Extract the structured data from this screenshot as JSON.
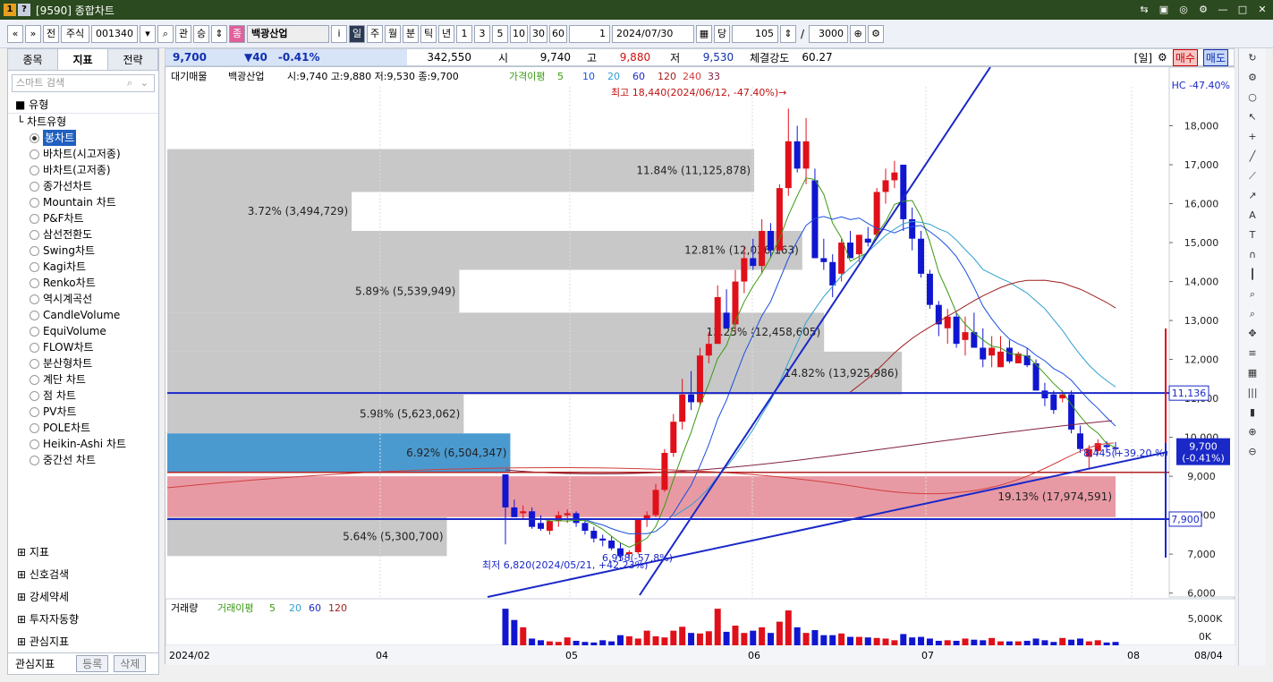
{
  "window": {
    "title": "[9590] 종합차트"
  },
  "toolbar": {
    "nav_prev": "«",
    "nav_down": "»",
    "prev_label": "전",
    "market": "주식",
    "code": "001340",
    "gwan": "관",
    "sang": "승",
    "stock_badge": "종",
    "stock_name": "백광산업",
    "info": "i",
    "periods": [
      "일",
      "주",
      "월",
      "분",
      "틱",
      "년"
    ],
    "counts": [
      "1",
      "3",
      "5",
      "10",
      "30",
      "60"
    ],
    "interval": "1",
    "date": "2024/07/30",
    "dang": "당",
    "view_count": "105",
    "slash": "/",
    "total_count": "3000"
  },
  "left_panel": {
    "tabs": [
      "종목",
      "지표",
      "전략"
    ],
    "search_placeholder": "스마트 검색",
    "section_title": "유형",
    "tree_root": "차트유형",
    "chart_types": [
      "봉차트",
      "바차트(시고저종)",
      "바차트(고저종)",
      "종가선차트",
      "Mountain 차트",
      "P&F차트",
      "삼선전환도",
      "Swing차트",
      "Kagi차트",
      "Renko차트",
      "역시계곡선",
      "CandleVolume",
      "EquiVolume",
      "FLOW차트",
      "분산형차트",
      "계단 차트",
      "점 차트",
      "PV차트",
      "POLE차트",
      "Heikin-Ashi 차트",
      "중간선 차트"
    ],
    "bottom_sections": [
      "지표",
      "신호검색",
      "강세약세",
      "투자자동향",
      "관심지표"
    ],
    "footer_label": "관심지표",
    "register": "등록",
    "delete": "삭제"
  },
  "quote": {
    "price": "9,700",
    "change": "▼40",
    "rate": "-0.41%",
    "volume": "342,550",
    "open_label": "시",
    "open": "9,740",
    "high_label": "고",
    "high": "9,880",
    "low_label": "저",
    "low": "9,530",
    "strength_label": "체결강도",
    "strength": "60.27",
    "period": "[일]",
    "buy": "매수",
    "sell": "매도"
  },
  "chart": {
    "legend_prefix": "대기매물",
    "legend_name": "백광산업",
    "legend_ohlc": "시:9,740 고:9,880 저:9,530 종:9,700",
    "ma_label": "가격이평",
    "ma_periods": [
      "5",
      "10",
      "20",
      "60",
      "120",
      "240",
      "33"
    ],
    "hc": "HC -47.40%",
    "high_note": "최고 18,440(2024/06/12, -47.40%)→",
    "low_note": "최저 6,820(2024/05/21, +42.23%)",
    "low_note2": "6,958(-57.8%)",
    "last_change_note": "8,445(+39.20 %)",
    "price_tag": "9,700",
    "price_tag2": "(-0.41%)",
    "line_tag_high": "11,136",
    "line_tag_low": "7,900",
    "x_labels": [
      "2024/02",
      "04",
      "05",
      "06",
      "07",
      "08"
    ],
    "x_right": "08/04",
    "volume_label": "거래량",
    "volume_ma_label": "거래이평",
    "volume_ma": [
      "5",
      "20",
      "60",
      "120"
    ],
    "volume_ticks": [
      "5,000K",
      "0K"
    ]
  },
  "chart_data": {
    "type": "bar",
    "y_ticks": [
      18000,
      17000,
      16000,
      15000,
      14000,
      13000,
      12000,
      11000,
      10000,
      9000,
      8000,
      7000,
      6000
    ],
    "y_tick_labels": [
      "18,000",
      "17,000",
      "16,000",
      "15,000",
      "14,000",
      "13,000",
      "12,000",
      "11,000",
      "10,000",
      "9,000",
      "8,000",
      "7,000",
      "6,000"
    ],
    "ylim": [
      5900,
      19000
    ],
    "volume_profile": [
      {
        "from": 17400,
        "to": 16300,
        "pct": 11.84,
        "label": "11.84% (11,125,878)"
      },
      {
        "from": 16300,
        "to": 15300,
        "pct": 3.72,
        "label": "3.72% (3,494,729)"
      },
      {
        "from": 15300,
        "to": 14300,
        "pct": 12.81,
        "label": "12.81% (12,036,163)"
      },
      {
        "from": 14300,
        "to": 13200,
        "pct": 5.89,
        "label": "5.89% (5,539,949)"
      },
      {
        "from": 13200,
        "to": 12200,
        "pct": 13.25,
        "label": "13.25% (12,458,605)"
      },
      {
        "from": 12200,
        "to": 11100,
        "pct": 14.82,
        "label": "14.82% (13,925,986)"
      },
      {
        "from": 11100,
        "to": 10100,
        "pct": 5.98,
        "label": "5.98% (5,623,062)"
      },
      {
        "from": 10100,
        "to": 9100,
        "pct": 6.92,
        "label": "6.92% (6,504,347)"
      },
      {
        "from": 9000,
        "to": 7950,
        "pct": 19.13,
        "label": "19.13% (17,974,591)"
      },
      {
        "from": 7950,
        "to": 6950,
        "pct": 5.64,
        "label": "5.64% (5,300,700)"
      }
    ],
    "candles": [
      [
        9050,
        9050,
        7250,
        8200
      ],
      [
        8200,
        8400,
        7950,
        7950
      ],
      [
        8050,
        8250,
        7900,
        8100
      ],
      [
        8100,
        8200,
        7650,
        7700
      ],
      [
        7800,
        8000,
        7600,
        7650
      ],
      [
        7600,
        7900,
        7500,
        7850
      ],
      [
        7850,
        8100,
        7700,
        8000
      ],
      [
        8000,
        8150,
        7800,
        8050
      ],
      [
        8050,
        8100,
        7700,
        7800
      ],
      [
        7800,
        7900,
        7500,
        7600
      ],
      [
        7600,
        7700,
        7300,
        7400
      ],
      [
        7400,
        7500,
        7200,
        7350
      ],
      [
        7350,
        7450,
        7100,
        7150
      ],
      [
        7150,
        7300,
        6820,
        6950
      ],
      [
        7000,
        7100,
        6900,
        7050
      ],
      [
        7050,
        7900,
        7000,
        7900
      ],
      [
        7900,
        8100,
        7700,
        8000
      ],
      [
        8000,
        8800,
        7950,
        8650
      ],
      [
        8650,
        9700,
        8600,
        9600
      ],
      [
        9600,
        10600,
        9500,
        10400
      ],
      [
        10400,
        11500,
        10200,
        11100
      ],
      [
        11100,
        11700,
        10700,
        10900
      ],
      [
        10900,
        12300,
        10800,
        12100
      ],
      [
        12100,
        12700,
        11900,
        12400
      ],
      [
        12400,
        13900,
        12400,
        13600
      ],
      [
        13200,
        13800,
        12800,
        12800
      ],
      [
        12900,
        14300,
        12700,
        14000
      ],
      [
        14000,
        14900,
        13700,
        14600
      ],
      [
        14600,
        15100,
        14300,
        14400
      ],
      [
        14400,
        15600,
        14200,
        15300
      ],
      [
        15300,
        15500,
        14600,
        14800
      ],
      [
        14800,
        16500,
        14700,
        16400
      ],
      [
        16400,
        18440,
        16200,
        17600
      ],
      [
        17600,
        18000,
        16800,
        16900
      ],
      [
        16900,
        18200,
        16500,
        17600
      ],
      [
        16600,
        16900,
        14600,
        14600
      ],
      [
        14600,
        15100,
        14300,
        14500
      ],
      [
        14500,
        14700,
        13600,
        13900
      ],
      [
        14200,
        15100,
        14000,
        15000
      ],
      [
        15000,
        15300,
        14600,
        14600
      ],
      [
        14700,
        15200,
        14500,
        15200
      ],
      [
        15100,
        15400,
        14900,
        15000
      ],
      [
        15200,
        16400,
        15100,
        16300
      ],
      [
        16300,
        16900,
        16000,
        16600
      ],
      [
        16600,
        17100,
        16400,
        16800
      ],
      [
        17000,
        17000,
        15300,
        15600
      ],
      [
        15600,
        15900,
        14800,
        15100
      ],
      [
        15100,
        15300,
        14100,
        14200
      ],
      [
        14200,
        14300,
        13300,
        13400
      ],
      [
        13400,
        13500,
        12600,
        12900
      ],
      [
        12800,
        13300,
        12400,
        13100
      ],
      [
        13100,
        13200,
        12300,
        12400
      ],
      [
        12500,
        13100,
        12100,
        12700
      ],
      [
        12700,
        13200,
        12300,
        12300
      ],
      [
        12300,
        12800,
        11800,
        12000
      ],
      [
        12100,
        12600,
        11800,
        12300
      ],
      [
        11800,
        12600,
        11800,
        12200
      ],
      [
        12300,
        12500,
        11900,
        11950
      ],
      [
        11900,
        12200,
        11900,
        12150
      ],
      [
        12100,
        12300,
        11800,
        11850
      ],
      [
        11900,
        12000,
        11200,
        11200
      ],
      [
        11200,
        11400,
        10800,
        11000
      ],
      [
        11100,
        11200,
        10600,
        10700
      ],
      [
        11000,
        11200,
        10900,
        11100
      ],
      [
        11100,
        11200,
        10100,
        10200
      ],
      [
        10100,
        10300,
        9600,
        9700
      ],
      [
        9500,
        9800,
        9200,
        9700
      ],
      [
        9650,
        9950,
        9550,
        9850
      ],
      [
        9800,
        9900,
        9600,
        9750
      ],
      [
        9740,
        9880,
        9530,
        9700
      ]
    ],
    "volume_max": 7000,
    "volume": [
      6500,
      4500,
      3200,
      1200,
      900,
      700,
      600,
      1400,
      800,
      600,
      500,
      900,
      700,
      1800,
      1600,
      1200,
      2600,
      1600,
      1400,
      2600,
      3300,
      2200,
      2100,
      2500,
      6500,
      2400,
      3500,
      2200,
      2600,
      3200,
      2200,
      4200,
      6200,
      3200,
      2200,
      2700,
      1800,
      1800,
      2100,
      1500,
      1500,
      1400,
      1300,
      1200,
      900,
      2000,
      1400,
      1500,
      1200,
      800,
      900,
      800,
      1200,
      1000,
      900,
      1300,
      700,
      700,
      700,
      800,
      1200,
      900,
      600,
      1300,
      1000,
      1200,
      700,
      900,
      500,
      600
    ]
  },
  "sidebar_icons": [
    "refresh-icon",
    "gear-icon",
    "circle-icon",
    "cursor-icon",
    "cross-icon",
    "line-icon",
    "line2-icon",
    "trend-icon",
    "auto-icon",
    "text-icon",
    "magnet-icon",
    "candle-icon",
    "zoom-icon",
    "search-icon",
    "pan-icon",
    "fib-icon",
    "grid-icon",
    "bars-icon",
    "hist-icon",
    "plus-icon",
    "minus-icon"
  ]
}
